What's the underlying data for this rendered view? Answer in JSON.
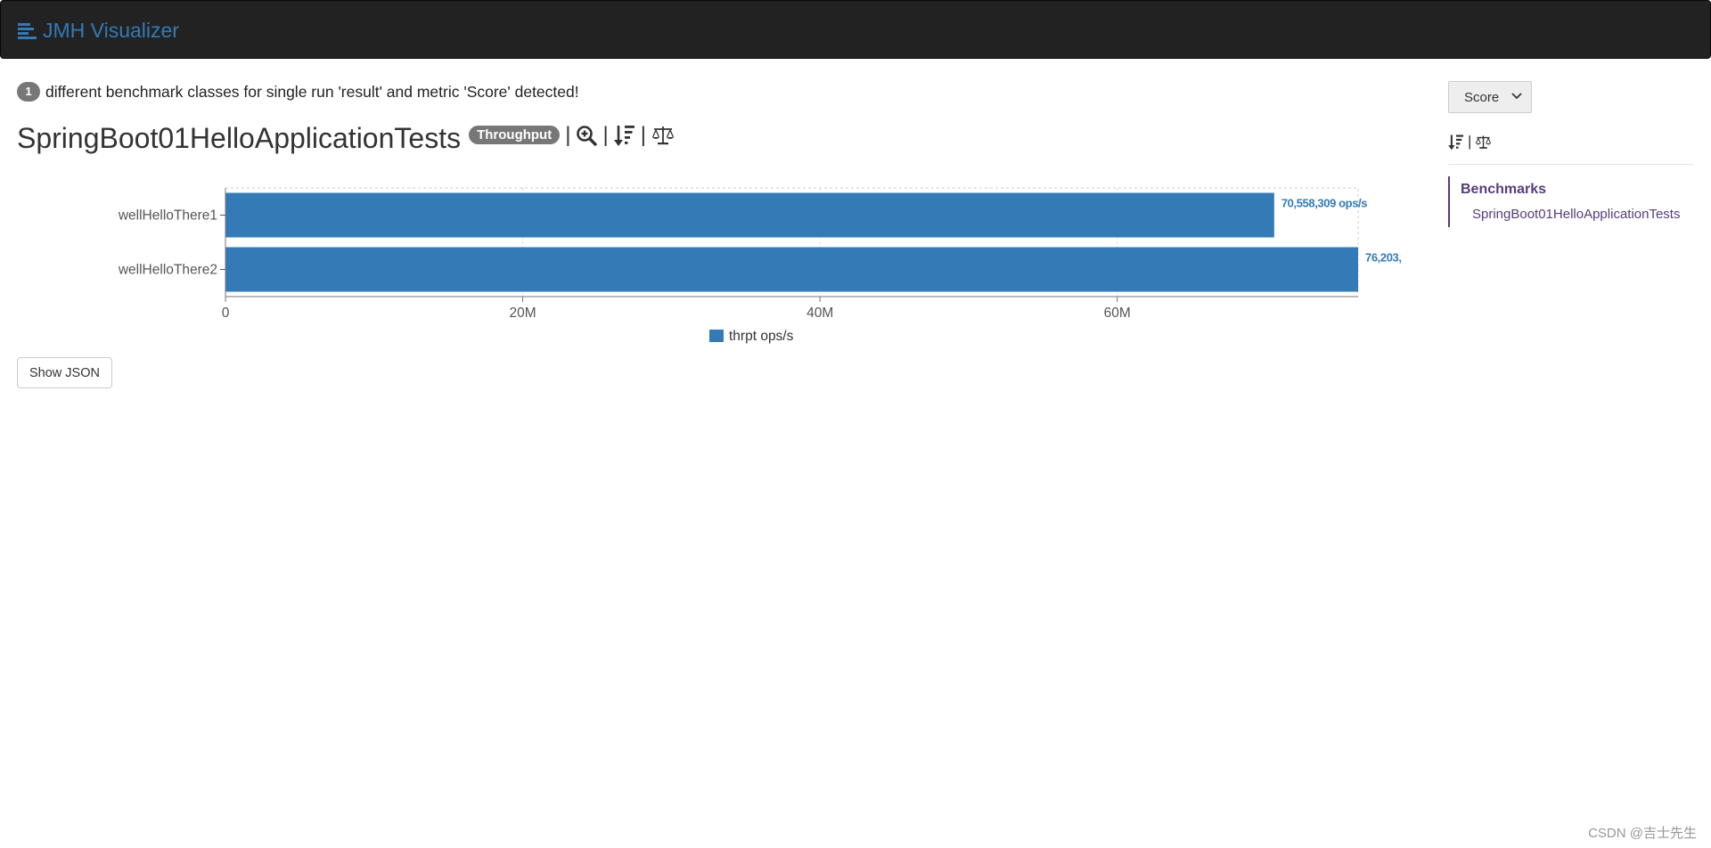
{
  "navbar": {
    "brand": "JMH Visualizer"
  },
  "summary": {
    "count": "1",
    "text": "different benchmark classes for single run 'result' and metric 'Score' detected!"
  },
  "benchmark": {
    "title": "SpringBoot01HelloApplicationTests",
    "mode": "Throughput",
    "sep": "|"
  },
  "chart_data": {
    "type": "bar",
    "orientation": "horizontal",
    "categories": [
      "wellHelloThere1",
      "wellHelloThere2"
    ],
    "series": [
      {
        "name": "thrpt ops/s",
        "values": [
          70558309,
          76203000
        ]
      }
    ],
    "data_labels": [
      "70,558,309 ops/s",
      "76,203,"
    ],
    "x_ticks": [
      0,
      20000000,
      40000000,
      60000000
    ],
    "x_tick_labels": [
      "0",
      "20M",
      "40M",
      "60M"
    ],
    "xlim": [
      0,
      76203000
    ],
    "legend": "bottom-center",
    "grid": true,
    "color": "#337ab7"
  },
  "buttons": {
    "show_json": "Show JSON"
  },
  "sidebar": {
    "metric_select": "Score",
    "sep": "|",
    "nav_title": "Benchmarks",
    "nav_items": [
      "SpringBoot01HelloApplicationTests"
    ]
  },
  "watermark": "CSDN @吉士先生"
}
